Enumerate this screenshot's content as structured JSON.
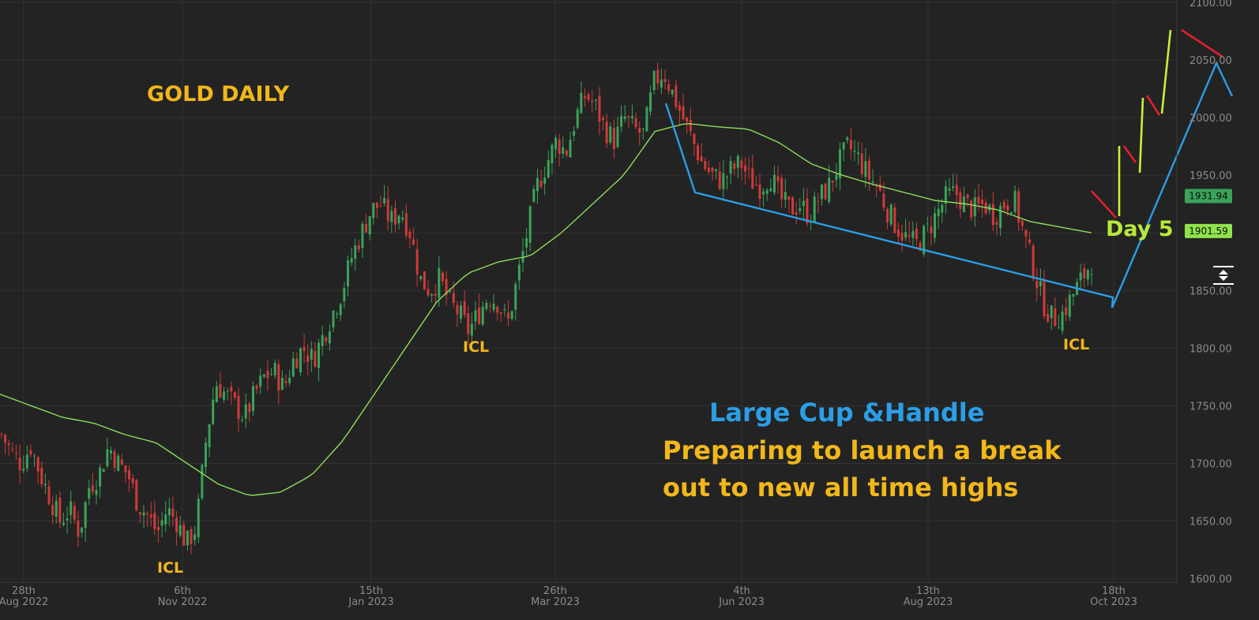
{
  "chart_data": {
    "type": "candlestick",
    "title": "GOLD DAILY",
    "x_tick_labels": [
      {
        "top": "28th",
        "bottom": "Aug 2022"
      },
      {
        "top": "6th",
        "bottom": "Nov 2022"
      },
      {
        "top": "15th",
        "bottom": "Jan 2023"
      },
      {
        "top": "26th",
        "bottom": "Mar 2023"
      },
      {
        "top": "4th",
        "bottom": "Jun 2023"
      },
      {
        "top": "13th",
        "bottom": "Aug 2023"
      },
      {
        "top": "18th",
        "bottom": "Oct 2023"
      }
    ],
    "y_ticks": [
      "1600.00",
      "1650.00",
      "1700.00",
      "1750.00",
      "1800.00",
      "1850.00",
      "1900.00",
      "1950.00",
      "2000.00",
      "2050.00",
      "2100.00"
    ],
    "ylim": [
      1597,
      2102
    ],
    "grid": true,
    "price_tags": [
      {
        "value": 1931.94,
        "label": "1931.94",
        "color": "#3aa35a"
      },
      {
        "value": 1901.59,
        "label": "1901.59",
        "color": "#8fe34a"
      }
    ],
    "close_series_approx": [
      1725,
      1710,
      1700,
      1715,
      1690,
      1670,
      1650,
      1660,
      1640,
      1680,
      1690,
      1715,
      1700,
      1690,
      1665,
      1655,
      1640,
      1660,
      1650,
      1630,
      1645,
      1720,
      1770,
      1760,
      1750,
      1740,
      1760,
      1775,
      1780,
      1765,
      1790,
      1800,
      1790,
      1810,
      1830,
      1850,
      1880,
      1900,
      1920,
      1925,
      1910,
      1920,
      1900,
      1860,
      1850,
      1860,
      1840,
      1830,
      1815,
      1830,
      1845,
      1840,
      1820,
      1860,
      1900,
      1940,
      1960,
      1980,
      1970,
      2000,
      2020,
      2010,
      1990,
      1980,
      2000,
      1990,
      1985,
      2030,
      2040,
      2020,
      2000,
      1980,
      1960,
      1950,
      1945,
      1955,
      1960,
      1945,
      1940,
      1950,
      1930,
      1920,
      1925,
      1915,
      1930,
      1940,
      1960,
      1975,
      1965,
      1950,
      1940,
      1920,
      1905,
      1895,
      1890,
      1900,
      1915,
      1930,
      1935,
      1925,
      1920,
      1925,
      1915,
      1925,
      1930,
      1900,
      1870,
      1840,
      1825,
      1830,
      1845,
      1860,
      1875
    ],
    "moving_average_approx": [
      1760,
      1750,
      1740,
      1735,
      1725,
      1718,
      1700,
      1682,
      1672,
      1675,
      1690,
      1720,
      1760,
      1800,
      1840,
      1865,
      1875,
      1880,
      1900,
      1925,
      1950,
      1988,
      1995,
      1992,
      1990,
      1978,
      1960,
      1950,
      1942,
      1935,
      1928,
      1925,
      1920,
      1910,
      1905,
      1900
    ],
    "annotations": {
      "labels_top": [
        "ICL",
        "ICL",
        "ICL"
      ],
      "day_label": "Day 5",
      "pattern_title": "Large Cup &Handle",
      "pattern_line1": "Preparing to launch a break",
      "pattern_line2": "out to new all time highs"
    },
    "colors": {
      "up": "#3aa35a",
      "down": "#d03a3a",
      "moving_average": "#8fdc5a",
      "cup_lines": "#2b9ee6",
      "title": "#f2b71b",
      "projection_up": "#c8f03a",
      "projection_down": "#e0202f",
      "day_label": "#b8e83a"
    }
  },
  "ui": {
    "reset_icon": "reset-scale-icon"
  }
}
